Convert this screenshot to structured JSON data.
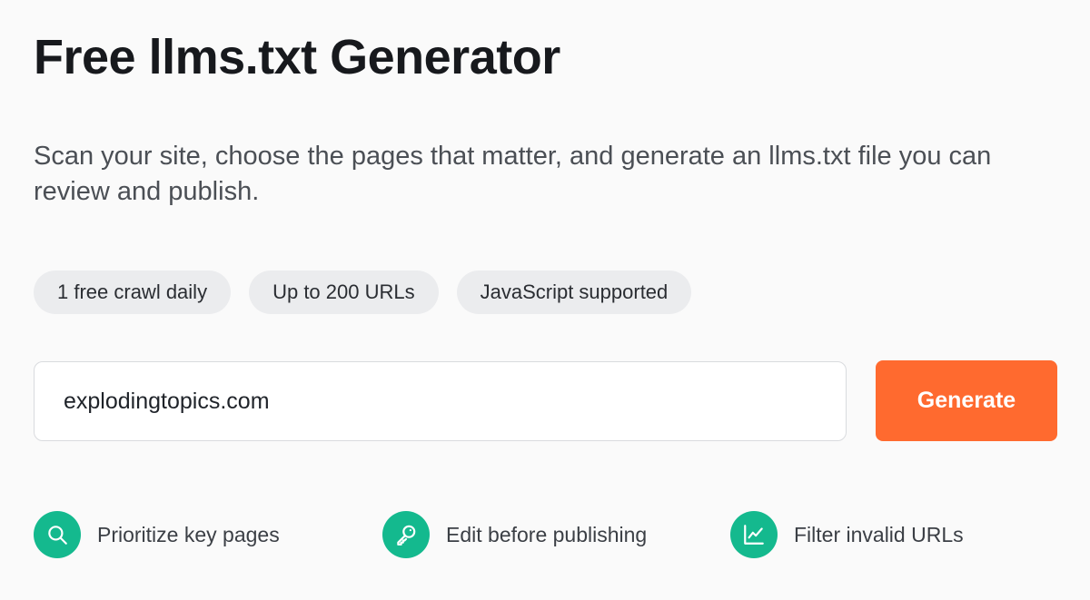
{
  "page": {
    "title": "Free llms.txt Generator",
    "subtitle": "Scan your site, choose the pages that matter, and generate an llms.txt file you can review and publish."
  },
  "chips": [
    {
      "label": "1 free crawl daily"
    },
    {
      "label": "Up to 200 URLs"
    },
    {
      "label": "JavaScript supported"
    }
  ],
  "form": {
    "url_value": "explodingtopics.com",
    "generate_label": "Generate"
  },
  "features": [
    {
      "label": "Prioritize key pages",
      "icon": "search-icon"
    },
    {
      "label": "Edit before publishing",
      "icon": "key-icon"
    },
    {
      "label": "Filter invalid URLs",
      "icon": "chart-icon"
    }
  ],
  "colors": {
    "accent": "#ff6a2f",
    "feature_icon_bg": "#14b98e",
    "chip_bg": "#ebecee",
    "background": "#fafafa"
  }
}
